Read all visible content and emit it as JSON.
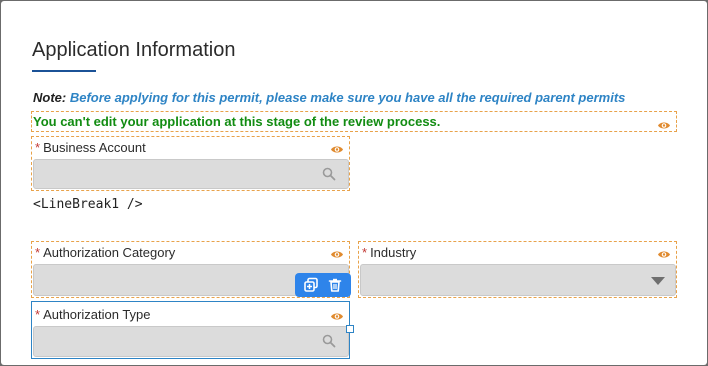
{
  "section": {
    "title": "Application Information"
  },
  "note": {
    "label": "Note:",
    "text": "Before applying for this permit, please make sure you have all the required parent permits"
  },
  "warning": {
    "text": "You can't edit your application at this stage of the review process."
  },
  "fields": {
    "business_account": {
      "label": "Business Account",
      "required": "*",
      "value": ""
    },
    "authorization_category": {
      "label": "Authorization Category",
      "required": "*",
      "value": ""
    },
    "industry": {
      "label": "Industry",
      "required": "*",
      "value": ""
    },
    "authorization_type": {
      "label": "Authorization Type",
      "required": "*",
      "value": ""
    }
  },
  "linebreak_tag": "<LineBreak1 />",
  "icons": {
    "visibility": "eye-icon",
    "search": "search-icon",
    "dropdown": "caret-down-icon",
    "duplicate": "duplicate-icon",
    "delete": "trash-icon"
  },
  "colors": {
    "accent_blue": "#2e84c5",
    "warning_green": "#128c12",
    "required_red": "#c23934",
    "dashed_outline": "#e8a24a",
    "eye_orange": "#e08a2e",
    "toolbar_blue": "#2e84ea"
  }
}
